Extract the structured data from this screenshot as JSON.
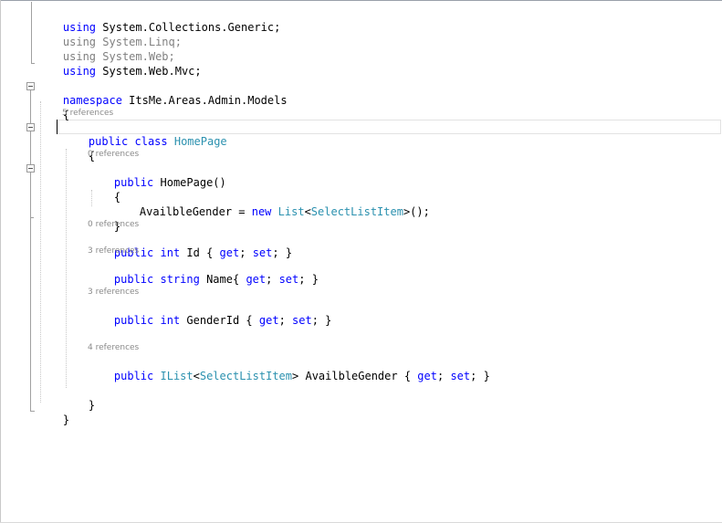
{
  "editor": {
    "usings": [
      {
        "keyword": "using",
        "ns": "System.Collections.Generic;",
        "dimmed": false
      },
      {
        "keyword": "using",
        "ns": "System.Linq;",
        "dimmed": true
      },
      {
        "keyword": "using",
        "ns": "System.Web;",
        "dimmed": true
      },
      {
        "keyword": "using",
        "ns": "System.Web.Mvc;",
        "dimmed": false
      }
    ],
    "namespace_keyword": "namespace",
    "namespace_name": "ItsMe.Areas.Admin.Models",
    "open_brace": "{",
    "close_brace": "}",
    "class_refs": "5 references",
    "public_kw": "public",
    "class_kw": "class",
    "class_name": "HomePage",
    "ctor_refs": "0 references",
    "ctor_name": "HomePage()",
    "ctor_body_target": "AvailbleGender = ",
    "new_kw": "new",
    "list_type": "List",
    "lt": "<",
    "select_type": "SelectListItem",
    "gt_call": ">();",
    "id_refs": "0 references",
    "int_kw": "int",
    "id_name": " Id { ",
    "get_kw": "get",
    "set_kw": "set",
    "prop_end": "; }",
    "semi_space": "; ",
    "name_refs": "3 references",
    "string_kw": "string",
    "name_name": " Name{ ",
    "gender_refs": "3 references",
    "gender_name": " GenderId { ",
    "avail_refs": "4 references",
    "ilist_type": "IList",
    "avail_name": "> AvailbleGender { "
  }
}
